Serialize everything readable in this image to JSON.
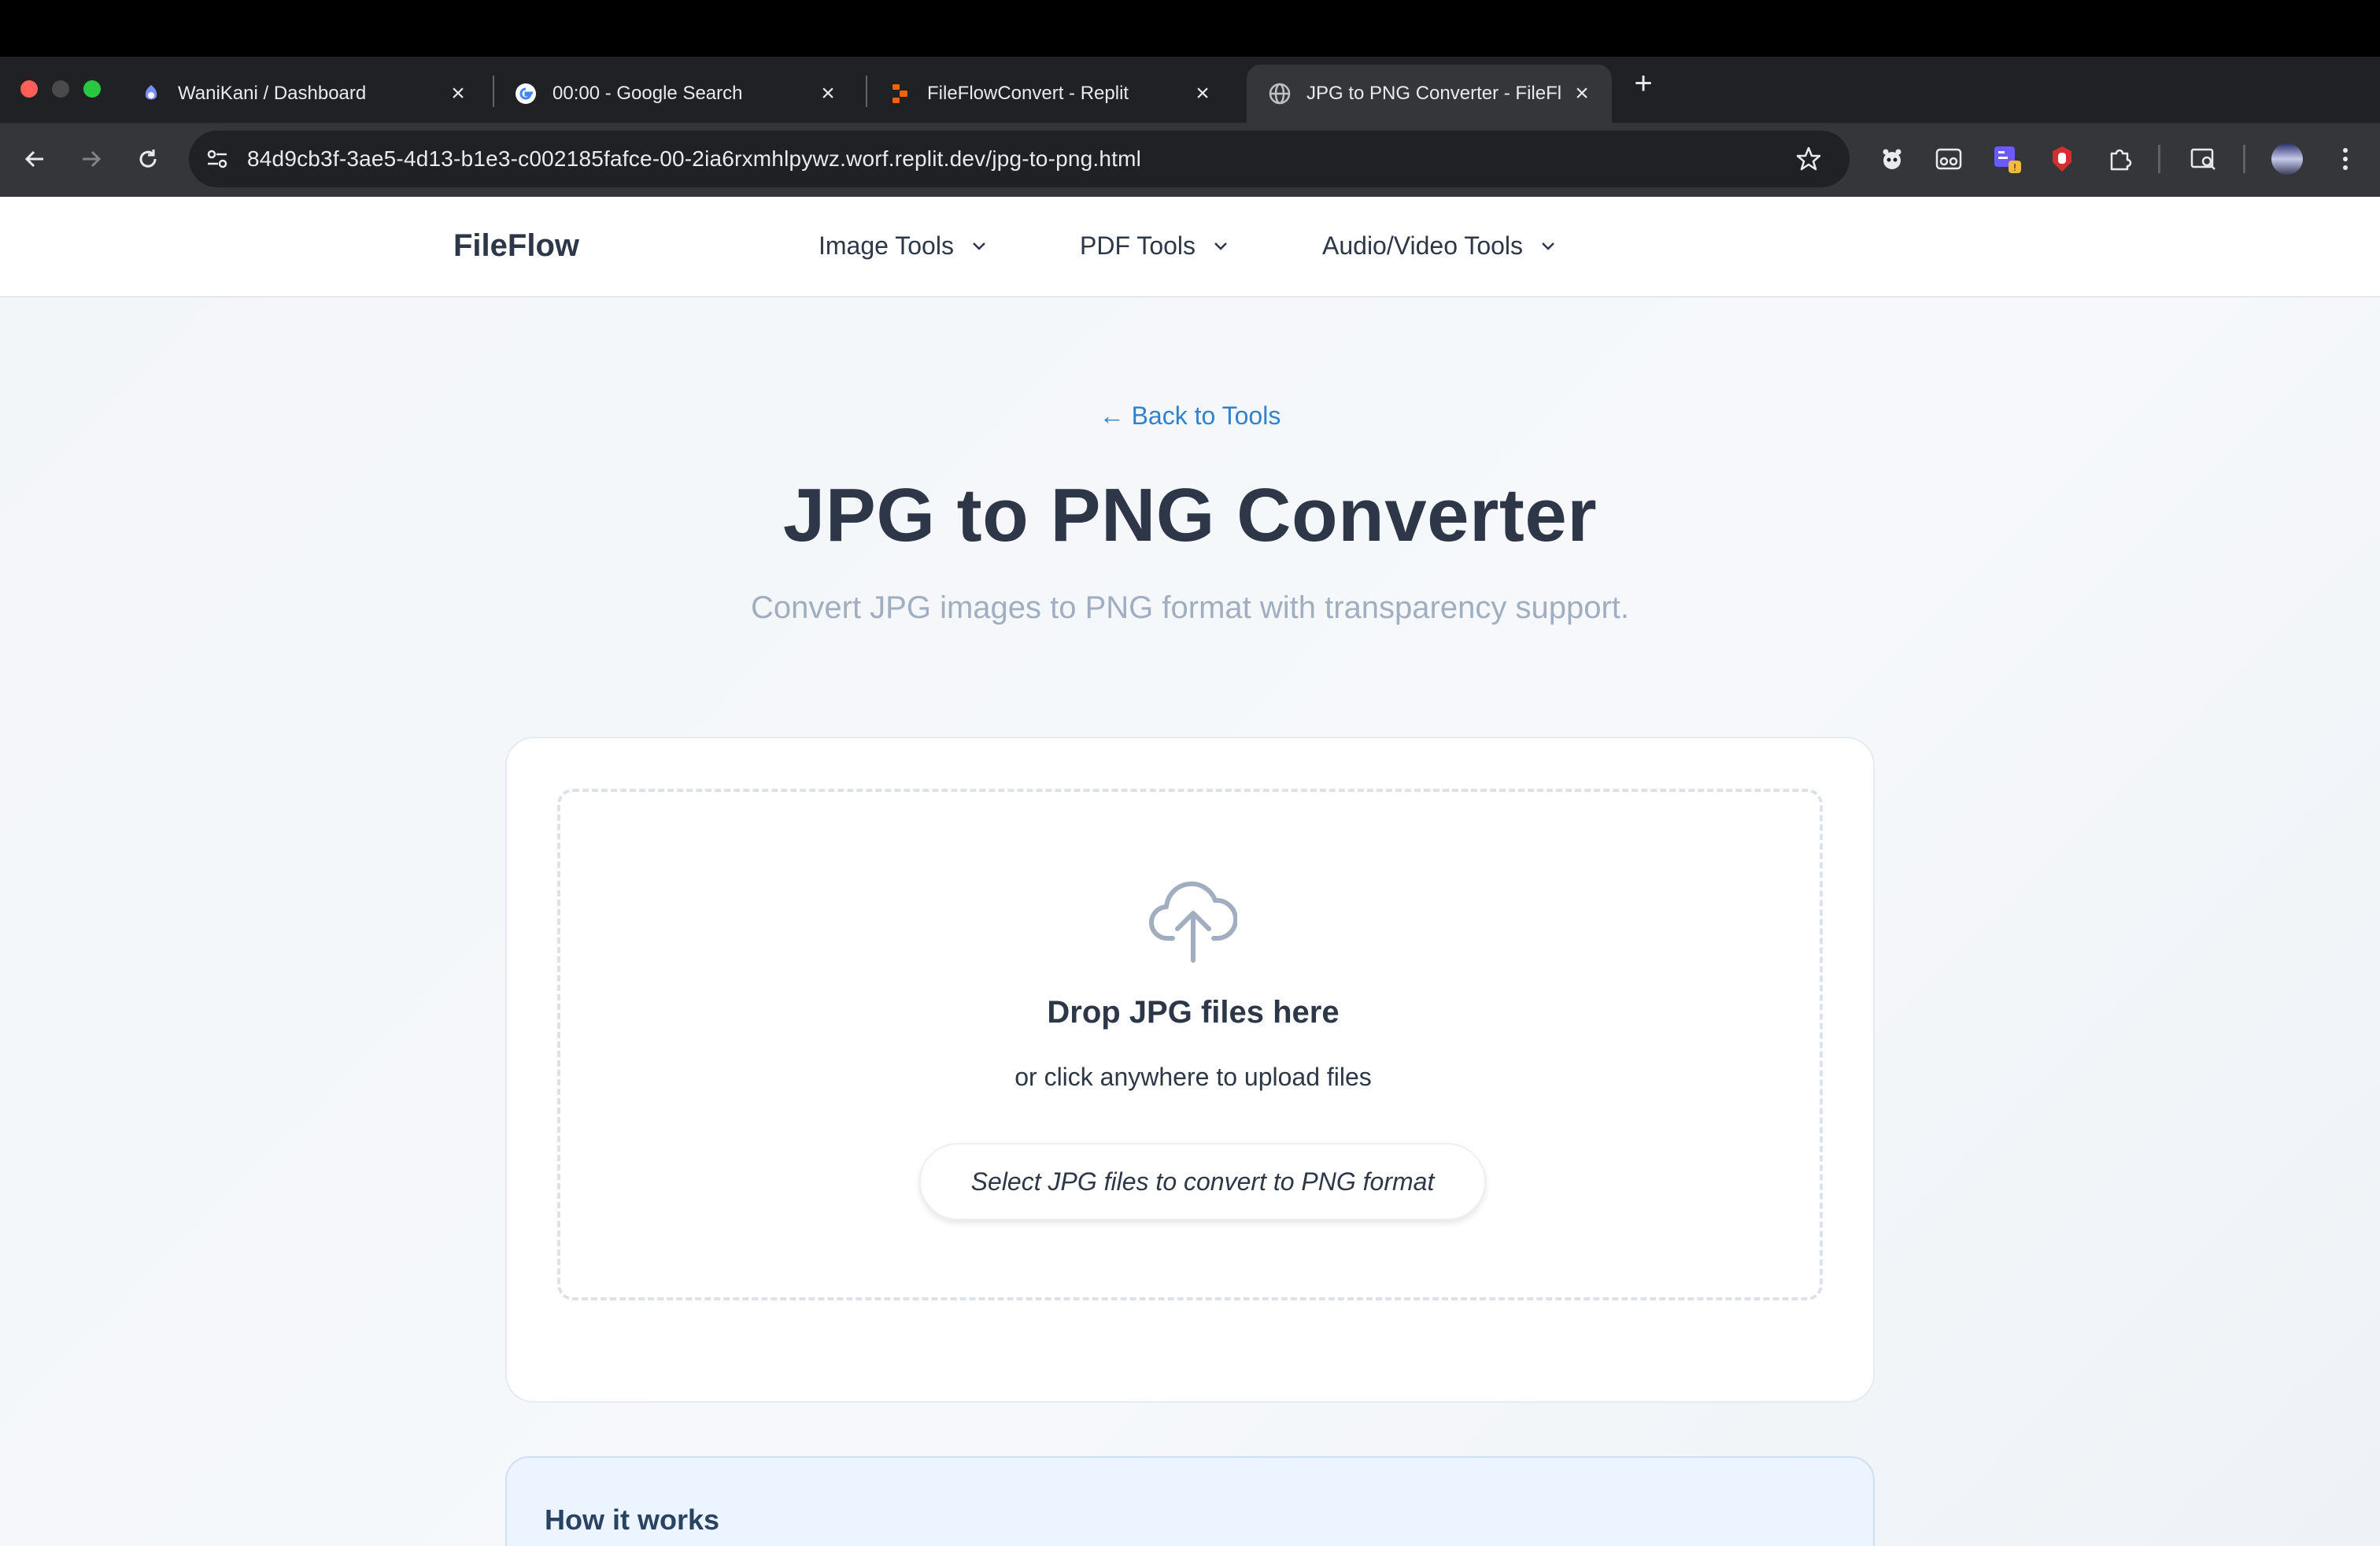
{
  "browser": {
    "tabs": [
      {
        "title": "WaniKani / Dashboard",
        "favicon": "wanikani-icon",
        "active": false
      },
      {
        "title": "00:00 - Google Search",
        "favicon": "google-icon",
        "active": false
      },
      {
        "title": "FileFlowConvert - Replit",
        "favicon": "replit-icon",
        "active": false
      },
      {
        "title": "JPG to PNG Converter - FileFl",
        "favicon": "globe-icon",
        "active": true
      }
    ],
    "url": "84d9cb3f-3ae5-4d13-b1e3-c002185fafce-00-2ia6rxmhlpywz.worf.replit.dev/jpg-to-png.html",
    "colors": {
      "chrome_dark": "#202124",
      "toolbar": "#35363a",
      "text": "#e8eaed"
    }
  },
  "site": {
    "brand": "FileFlow",
    "nav": [
      {
        "label": "Image Tools",
        "icon": "chevron-down-icon"
      },
      {
        "label": "PDF Tools",
        "icon": "chevron-down-icon"
      },
      {
        "label": "Audio/Video Tools",
        "icon": "chevron-down-icon"
      }
    ]
  },
  "main": {
    "back_link": "← Back to Tools",
    "title": "JPG to PNG Converter",
    "subtitle": "Convert JPG images to PNG format with transparency support.",
    "upload": {
      "icon": "cloud-upload-icon",
      "heading": "Drop JPG files here",
      "subheading": "or click anywhere to upload files",
      "button_label": "Select JPG files to convert to PNG format"
    },
    "how_it_works": {
      "title": "How it works"
    }
  },
  "colors": {
    "accent": "#3182ce",
    "heading": "#2d3748",
    "muted": "#a0aec0",
    "info_bg": "#ebf4ff"
  }
}
